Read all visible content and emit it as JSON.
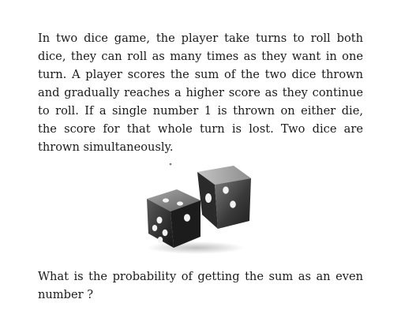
{
  "problem": {
    "intro_lines": [
      "In two dice game, the player take turns to roll both",
      "dice, they can roll as many times as they want in one",
      "turn. A player scores the sum of the two dice thrown",
      "and gradually reaches a higher score as they continue",
      "to roll. If a single number 1 is thrown on either die,",
      "the score for that whole turn is lost. Two dice are",
      "thrown simultaneously."
    ],
    "question_lines": [
      "What is the probability of getting the sum as an even",
      "number ?"
    ]
  },
  "image": {
    "icon": "two-dice-icon"
  }
}
